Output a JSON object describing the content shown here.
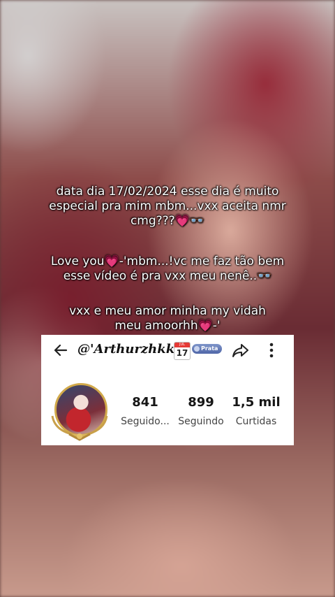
{
  "caption": {
    "line1a": "data dia 17/02/2024 esse dia é muito",
    "line1b": "especial pra mim mbm...vxx aceita nmr",
    "line1c": "cmg???💗👓",
    "line2a": "Love you💗-'mbm...!vc me faz tão bem",
    "line2b": "esse vídeo é pra vxx meu nenê..👓",
    "line3a": "vxx e meu amor minha my vidah",
    "line3b": "meu amoorhh💗-'"
  },
  "profile": {
    "username": "@'Arthurzhkk..!",
    "calendar_month": "JUL",
    "calendar_day": "17",
    "badge_label": "Prata",
    "stats": [
      {
        "value": "841",
        "label": "Seguido..."
      },
      {
        "value": "899",
        "label": "Seguindo"
      },
      {
        "value": "1,5 mil",
        "label": "Curtidas"
      }
    ]
  },
  "icons": {
    "back": "back-arrow-icon",
    "share": "share-icon",
    "more": "more-vertical-icon"
  }
}
